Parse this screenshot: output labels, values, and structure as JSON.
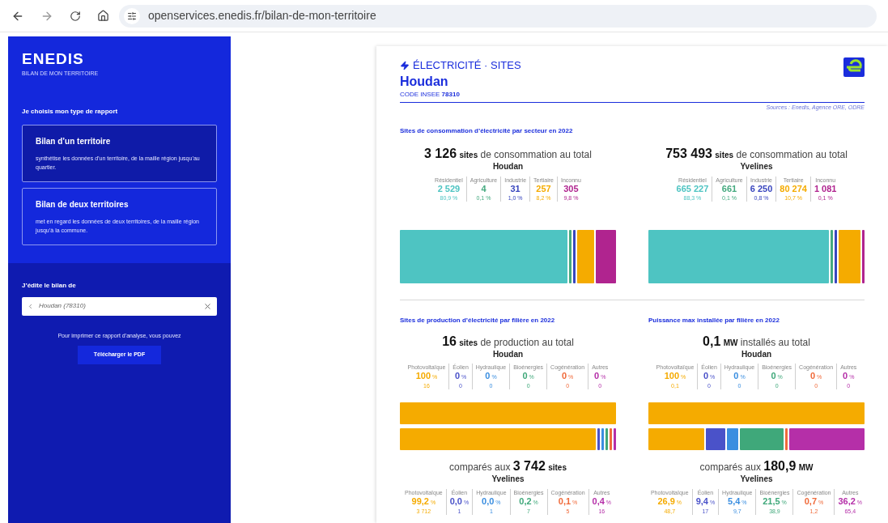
{
  "browser": {
    "url": "openservices.enedis.fr/bilan-de-mon-territoire"
  },
  "sidebar": {
    "logo": "ENEDIS",
    "subtitle": "BILAN DE MON TERRITOIRE",
    "section_title": "Je choisis mon type de rapport",
    "report_types": [
      {
        "title": "Bilan d’un territoire",
        "description": "synthétise les données d’un territoire, de la maille région jusqu’au quartier.",
        "selected": true
      },
      {
        "title": "Bilan de deux territoires",
        "description": "met en regard les données de deux territoires, de la maille région jusqu’à la commune.",
        "selected": false
      }
    ],
    "edit_label": "J’édite le bilan de",
    "search": {
      "value": "Houdan (78310)"
    },
    "print_note": "Pour imprimer ce rapport d’analyse, vous pouvez",
    "download_button": "Télécharger le PDF"
  },
  "report": {
    "category": "ÉLECTRICITÉ · SITES",
    "place": "Houdan",
    "code_label": "CODE INSEE",
    "code": "78310",
    "sources": "Sources : Enedis, Agence ORE, ODRE",
    "consumption": {
      "title": "Sites de consommation d’électricité par secteur en 2022",
      "panels": [
        {
          "total": "3 126",
          "unit": "sites",
          "rest": "de consommation au total",
          "place": "Houdan",
          "items": [
            {
              "label": "Résidentiel",
              "value": "2 529",
              "sub": "80,9 %",
              "color": "#4ec4c2"
            },
            {
              "label": "Agriculture",
              "value": "4",
              "sub": "0,1 %",
              "color": "#45a97f"
            },
            {
              "label": "Industrie",
              "value": "31",
              "sub": "1,0 %",
              "color": "#3946be"
            },
            {
              "label": "Tertiaire",
              "value": "257",
              "sub": "8,2 %",
              "color": "#f5ab00"
            },
            {
              "label": "Inconnu",
              "value": "305",
              "sub": "9,8 %",
              "color": "#b0248f"
            }
          ]
        },
        {
          "total": "753 493",
          "unit": "sites",
          "rest": "de consommation au total",
          "place": "Yvelines",
          "items": [
            {
              "label": "Résidentiel",
              "value": "665 227",
              "sub": "88,3 %",
              "color": "#4ec4c2"
            },
            {
              "label": "Agriculture",
              "value": "661",
              "sub": "0,1 %",
              "color": "#45a97f"
            },
            {
              "label": "Industrie",
              "value": "6 250",
              "sub": "0,8 %",
              "color": "#3946be"
            },
            {
              "label": "Tertiaire",
              "value": "80 274",
              "sub": "10,7 %",
              "color": "#f5ab00"
            },
            {
              "label": "Inconnu",
              "value": "1 081",
              "sub": "0,1 %",
              "color": "#b0248f"
            }
          ]
        }
      ]
    },
    "production": {
      "panels": [
        {
          "title": "Sites de production d’électricité par filière en 2022",
          "summary": {
            "total": "16",
            "unit": "sites",
            "rest": "de production au total",
            "place": "Houdan",
            "items": [
              {
                "label": "Photovoltaïque",
                "value": "100",
                "unit": "%",
                "sub": "16",
                "color": "#f5ab00"
              },
              {
                "label": "Éolien",
                "value": "0",
                "unit": "%",
                "sub": "0",
                "color": "#4a52c9"
              },
              {
                "label": "Hydraulique",
                "value": "0",
                "unit": "%",
                "sub": "0",
                "color": "#3a8ee0"
              },
              {
                "label": "Bioénergies",
                "value": "0",
                "unit": "%",
                "sub": "0",
                "color": "#3fa87a"
              },
              {
                "label": "Cogénération",
                "value": "0",
                "unit": "%",
                "sub": "0",
                "color": "#f06a3a"
              },
              {
                "label": "Autres",
                "value": "0",
                "unit": "%",
                "sub": "0",
                "color": "#b52fa8"
              }
            ]
          },
          "compare": {
            "lead": "comparés aux",
            "total": "3 742",
            "unit": "sites",
            "place": "Yvelines",
            "items": [
              {
                "label": "Photovoltaïque",
                "value": "99,2",
                "unit": "%",
                "sub": "3 712",
                "color": "#f5ab00"
              },
              {
                "label": "Éolien",
                "value": "0,0",
                "unit": "%",
                "sub": "1",
                "color": "#4a52c9"
              },
              {
                "label": "Hydraulique",
                "value": "0,0",
                "unit": "%",
                "sub": "1",
                "color": "#3a8ee0"
              },
              {
                "label": "Bioénergies",
                "value": "0,2",
                "unit": "%",
                "sub": "7",
                "color": "#3fa87a"
              },
              {
                "label": "Cogénération",
                "value": "0,1",
                "unit": "%",
                "sub": "5",
                "color": "#f06a3a"
              },
              {
                "label": "Autres",
                "value": "0,4",
                "unit": "%",
                "sub": "16",
                "color": "#b52fa8"
              }
            ]
          }
        },
        {
          "title": "Puissance max installée par filière en 2022",
          "summary": {
            "total": "0,1",
            "unit": "MW",
            "rest": "installés au total",
            "place": "Houdan",
            "items": [
              {
                "label": "Photovoltaïque",
                "value": "100",
                "unit": "%",
                "sub": "0,1",
                "color": "#f5ab00"
              },
              {
                "label": "Éolien",
                "value": "0",
                "unit": "%",
                "sub": "0",
                "color": "#4a52c9"
              },
              {
                "label": "Hydraulique",
                "value": "0",
                "unit": "%",
                "sub": "0",
                "color": "#3a8ee0"
              },
              {
                "label": "Bioénergies",
                "value": "0",
                "unit": "%",
                "sub": "0",
                "color": "#3fa87a"
              },
              {
                "label": "Cogénération",
                "value": "0",
                "unit": "%",
                "sub": "0",
                "color": "#f06a3a"
              },
              {
                "label": "Autres",
                "value": "0",
                "unit": "%",
                "sub": "0",
                "color": "#b52fa8"
              }
            ]
          },
          "compare": {
            "lead": "comparés aux",
            "total": "180,9",
            "unit": "MW",
            "place": "Yvelines",
            "items": [
              {
                "label": "Photovoltaïque",
                "value": "26,9",
                "unit": "%",
                "sub": "48,7",
                "color": "#f5ab00"
              },
              {
                "label": "Éolien",
                "value": "9,4",
                "unit": "%",
                "sub": "17",
                "color": "#4a52c9"
              },
              {
                "label": "Hydraulique",
                "value": "5,4",
                "unit": "%",
                "sub": "9,7",
                "color": "#3a8ee0"
              },
              {
                "label": "Bioénergies",
                "value": "21,5",
                "unit": "%",
                "sub": "38,9",
                "color": "#3fa87a"
              },
              {
                "label": "Cogénération",
                "value": "0,7",
                "unit": "%",
                "sub": "1,2",
                "color": "#f06a3a"
              },
              {
                "label": "Autres",
                "value": "36,2",
                "unit": "%",
                "sub": "65,4",
                "color": "#b52fa8"
              }
            ]
          }
        }
      ]
    }
  }
}
